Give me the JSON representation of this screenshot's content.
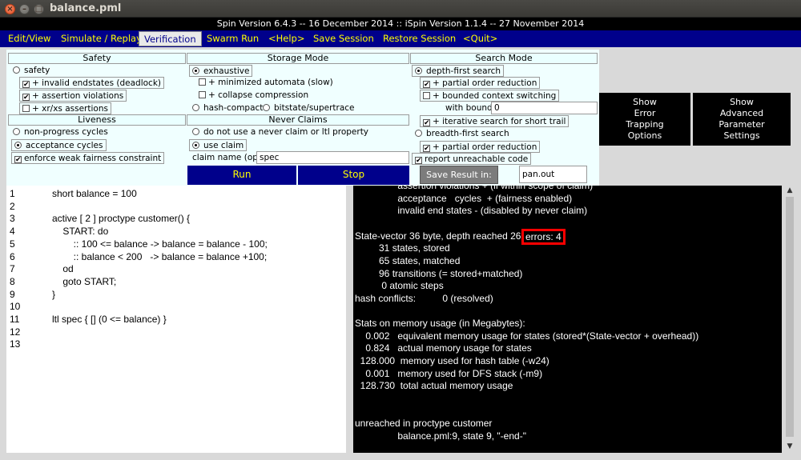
{
  "window": {
    "title": "balance.pml"
  },
  "version_line": "Spin Version 6.4.3 -- 16 December 2014 :: iSpin Version 1.1.4 -- 27 November 2014",
  "menu": [
    "Edit/View",
    "Simulate / Replay",
    "Verification",
    "Swarm Run",
    "<Help>",
    "Save Session",
    "Restore Session",
    "<Quit>"
  ],
  "active_menu": "Verification",
  "safety": {
    "header": "Safety",
    "safety_label": "safety",
    "invalid_endstates": "+ invalid endstates (deadlock)",
    "assertion_violations": "+ assertion violations",
    "xr_xs": "+ xr/xs assertions"
  },
  "liveness": {
    "header": "Liveness",
    "non_progress": "non-progress cycles",
    "acceptance": "acceptance cycles",
    "weak_fairness": "enforce weak fairness constraint"
  },
  "storage": {
    "header": "Storage Mode",
    "exhaustive": "exhaustive",
    "minimized": "+ minimized automata (slow)",
    "collapse": "+ collapse compression",
    "hash_compact": "hash-compact",
    "bitstate": "bitstate/supertrace"
  },
  "never_claims": {
    "header": "Never Claims",
    "no_claim": "do not use a never claim or ltl property",
    "use_claim": "use claim",
    "claim_name_label": "claim name (opt):",
    "claim_name_value": "spec"
  },
  "search": {
    "header": "Search Mode",
    "dfs": "depth-first search",
    "partial_order": "+ partial order reduction",
    "bounded_context": "+ bounded context switching",
    "with_bound_label": "with bound:",
    "with_bound_value": "0",
    "iterative": "+ iterative search for short trail",
    "bfs": "breadth-first search",
    "partial_order_bfs": "+ partial order reduction",
    "report_unreachable": "report unreachable code"
  },
  "buttons": {
    "run": "Run",
    "stop": "Stop",
    "save_result": "Save Result in:",
    "save_file": "pan.out",
    "error_trapping": [
      "Show",
      "Error",
      "Trapping",
      "Options"
    ],
    "advanced": [
      "Show",
      "Advanced",
      "Parameter",
      "Settings"
    ]
  },
  "editor": {
    "line_numbers": [
      "1",
      "2",
      "3",
      "4",
      "5",
      "6",
      "7",
      "8",
      "9",
      "10",
      "11",
      "12",
      "13"
    ],
    "code": [
      "short balance = 100",
      "",
      "active [ 2 ] proctype customer() {",
      "    START: do",
      "        :: 100 <= balance -> balance = balance - 100;",
      "        :: balance < 200   -> balance = balance +100;",
      "    od",
      "    goto START;",
      "}",
      "",
      "ltl spec { [] (0 <= balance) }",
      "",
      ""
    ]
  },
  "output": {
    "lines": [
      "                assertion violations + (if within scope of claim)",
      "                acceptance   cycles  + (fairness enabled)",
      "                invalid end states - (disabled by never claim)",
      "",
      "State-vector 36 byte, depth reached 26, ",
      "         31 states, stored",
      "         65 states, matched",
      "         96 transitions (= stored+matched)",
      "          0 atomic steps",
      "hash conflicts:          0 (resolved)",
      "",
      "Stats on memory usage (in Megabytes):",
      "    0.002   equivalent memory usage for states (stored*(State-vector + overhead))",
      "    0.824   actual memory usage for states",
      "  128.000  memory used for hash table (-w24)",
      "    0.001   memory used for DFS stack (-m9)",
      "  128.730  total actual memory usage",
      "",
      "",
      "unreached in proctype customer",
      "                balance.pml:9, state 9, \"-end-\""
    ],
    "errors_highlight": "errors: 4"
  },
  "colors": {
    "menubar": "#00008b",
    "menu_text": "#ffff00",
    "panel_bg": "#f0ffff",
    "highlight": "#ff0000"
  }
}
